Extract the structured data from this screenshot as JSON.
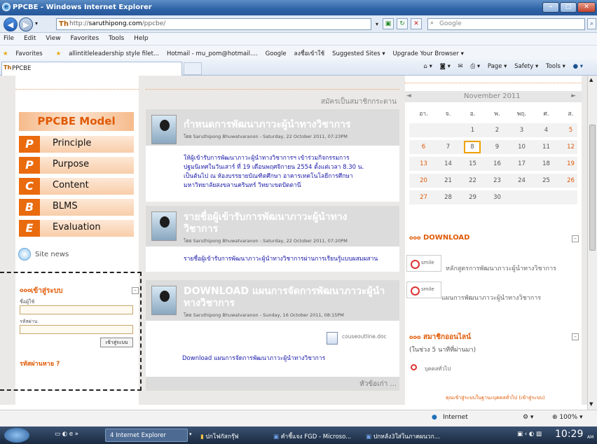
{
  "window": {
    "title": "PPCBE - Windows Internet Explorer"
  },
  "address": {
    "prefix": "http://",
    "domain": "saruthipong.com",
    "path": "/ppcbe/",
    "search_placeholder": "Google"
  },
  "menu": [
    "File",
    "Edit",
    "View",
    "Favorites",
    "Tools",
    "Help"
  ],
  "favorites": {
    "label": "Favorites",
    "items": [
      "allintitleleadership style filet...",
      "Hotmail - mu_pom@hotmail....",
      "Google",
      "ลงชื่อเข้าใช้",
      "Suggested Sites ▾",
      "Upgrade Your Browser ▾"
    ]
  },
  "tab": {
    "label": "PPCBE"
  },
  "commands": [
    "Page ▾",
    "Safety ▾",
    "Tools ▾"
  ],
  "marquee": "สมัครเป็นสมาชิกกระดาน",
  "model": {
    "title": "PPCBE Model",
    "items": [
      {
        "letter": "P",
        "label": "Principle"
      },
      {
        "letter": "P",
        "label": "Purpose"
      },
      {
        "letter": "C",
        "label": "Content"
      },
      {
        "letter": "B",
        "label": "BLMS"
      },
      {
        "letter": "E",
        "label": "Evaluation"
      }
    ]
  },
  "site_news": "Site news",
  "login": {
    "title": "เข้าสู่ระบบ",
    "username_label": "ชื่อผู้ใช้",
    "password_label": "รหัสผ่าน",
    "button": "เข้าสู่ระบบ",
    "forgot": "รหัสผ่านหาย ?"
  },
  "posts": [
    {
      "title": "กำหนดการพัฒนาภาวะผู้นำทางวิชาการ",
      "meta": "โดย Saruthipong Bhuwatvaranon - Saturday, 22 October 2011, 07:23PM",
      "body": [
        "ให้ผู้เข้ารับการพัฒนาภาวะผู้นำทางวิชาการฯ เข้าร่วมกิจกรรมการ",
        "ปฐมนิเทศในวันเสาร์ ที่ 19 เดือนพฤศจิกายน 2554 ตั้งแต่เวลา 8.30 น.",
        "เป็นต้นไป ณ ห้องบรรยายบัณฑิตศึกษา อาคารเทคโนโลยีการศึกษา",
        "มหาวิทยาลัยสงขลานครินทร์ วิทยาเขตปัตตานี"
      ]
    },
    {
      "title": "รายชื่อผู้เข้ารับการพัฒนาภาวะผู้นำทาง",
      "title2": "วิชาการ",
      "meta": "โดย Saruthipong Bhuwatvaranon - Saturday, 22 October 2011, 07:20PM",
      "body": [
        "รายชื่อผู้เข้ารับการพัฒนาภาวะผู้นำทางวิชาการผ่านการเรียนรู้แบบผสมผสาน"
      ]
    },
    {
      "title": "DOWNLOAD แผนการจัดการพัฒนาภาวะผู้นำ",
      "title2": "ทางวิชาการ",
      "meta": "โดย Saruthipong Bhuwatvaranon - Sunday, 16 October 2011, 08:15PM",
      "attachment": "couseoutline.doc",
      "body": [
        "Download แผนการจัดการพัฒนาภาวะผู้นำทางวิชาการ"
      ]
    }
  ],
  "older": "หัวข้อเก่า ...",
  "calendar": {
    "month": "November 2011",
    "prev": "◄",
    "next": "►",
    "days": [
      "อา.",
      "จ.",
      "อ.",
      "พ.",
      "พฤ.",
      "ศ.",
      "ส."
    ],
    "weeks": [
      [
        "",
        "",
        "1",
        "2",
        "3",
        "4",
        "5"
      ],
      [
        "6",
        "7",
        "8",
        "9",
        "10",
        "11",
        "12"
      ],
      [
        "13",
        "14",
        "15",
        "16",
        "17",
        "18",
        "19"
      ],
      [
        "20",
        "21",
        "22",
        "23",
        "24",
        "25",
        "26"
      ],
      [
        "27",
        "28",
        "29",
        "30",
        "",
        "",
        ""
      ]
    ],
    "today": "8"
  },
  "download": {
    "title": "DOWNLOAD",
    "items": [
      {
        "icon_text": "smile",
        "label": "หลักสูตรการพัฒนาภาวะผู้นำทางวิชาการ"
      },
      {
        "icon_text": "smile",
        "label": "แผนการพัฒนาภาวะผู้นำทางวิชาการ"
      }
    ]
  },
  "online": {
    "title": "สมาชิกออนไลน์",
    "subtitle": "(ในช่วง 5 นาทีที่ผ่านมา)",
    "user": "บุคคลทั่วไป"
  },
  "footer_link": "คุณเข้าสู่ระบบในฐานะบุคคลทั่วไป (เข้าสู่ระบบ)",
  "status": {
    "zone": "Internet",
    "zoom": "100%"
  },
  "taskbar": {
    "items": [
      "4 Internet Explorer",
      "ปกโฟกัสกรุ๊ฟ",
      "คำชี้แจง FGD - Microso...",
      "ปกหลัง3ใส่ในภาคผนวก..."
    ],
    "time": "10:29",
    "ampm": "AM"
  },
  "colors": {
    "accent": "#e05a06",
    "link": "#1a1aa8",
    "chrome": "#2e63a6"
  }
}
